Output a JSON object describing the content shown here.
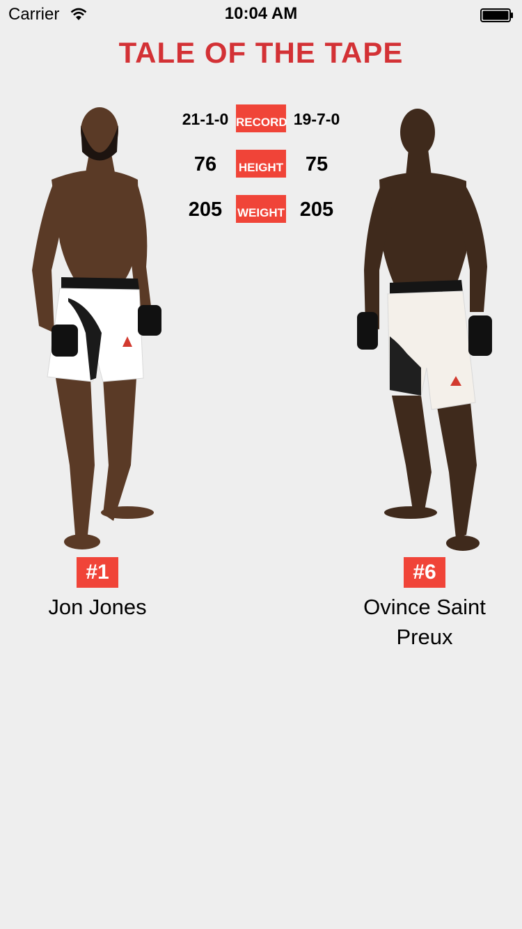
{
  "status_bar": {
    "carrier": "Carrier",
    "time": "10:04 AM"
  },
  "title": "TALE OF THE TAPE",
  "colors": {
    "accent": "#f04438",
    "title": "#d33135",
    "background": "#eeeeee"
  },
  "stats": [
    {
      "label": "RECORD",
      "left": "21-1-0",
      "right": "19-7-0"
    },
    {
      "label": "HEIGHT",
      "left": "76",
      "right": "75"
    },
    {
      "label": "WEIGHT",
      "left": "205",
      "right": "205"
    }
  ],
  "fighters": {
    "left": {
      "rank": "#1",
      "name": "Jon Jones"
    },
    "right": {
      "rank": "#6",
      "name": "Ovince Saint Preux"
    }
  }
}
